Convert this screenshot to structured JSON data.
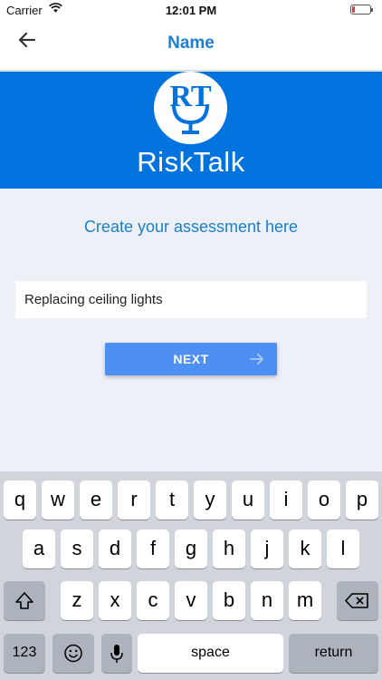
{
  "status_bar": {
    "carrier": "Carrier",
    "time": "12:01 PM"
  },
  "nav": {
    "title": "Name",
    "back_icon": "arrow-left-icon"
  },
  "banner": {
    "logo_text": "RiskTalk",
    "logo_mark": "RT",
    "logo_icon": "microphone-icon",
    "background": "#0073de"
  },
  "main": {
    "heading": "Create your assessment here",
    "name_input_value": "Replacing ceiling lights",
    "next_label": "NEXT",
    "accent": "#4d8ff2"
  },
  "keyboard": {
    "row1": [
      "q",
      "w",
      "e",
      "r",
      "t",
      "y",
      "u",
      "i",
      "o",
      "p"
    ],
    "row2": [
      "a",
      "s",
      "d",
      "f",
      "g",
      "h",
      "j",
      "k",
      "l"
    ],
    "row3": [
      "z",
      "x",
      "c",
      "v",
      "b",
      "n",
      "m"
    ],
    "numbers_label": "123",
    "space_label": "space",
    "return_label": "return"
  }
}
